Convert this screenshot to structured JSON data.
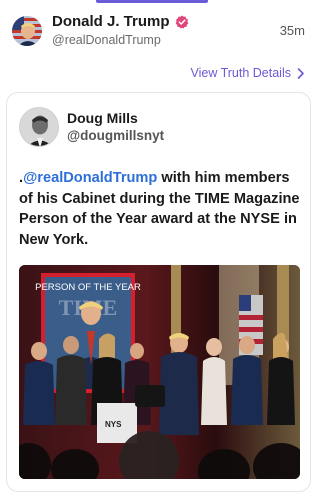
{
  "post": {
    "author": "Donald J. Trump",
    "handle": "@realDonaldTrump",
    "time": "35m",
    "view_details": "View Truth Details"
  },
  "quote": {
    "author": "Doug Mills",
    "handle": "@dougmillsnyt",
    "text_prefix": ".",
    "mention": "@realDonaldTrump",
    "text_rest": " with him members of his Cabinet  during the TIME Magazine Person of the Year award at the NYSE in New York.",
    "photo": {
      "cover_title": "PERSON OF THE YEAR",
      "cover_masthead": "TIME",
      "podium_label": "NYS"
    }
  },
  "colors": {
    "accent": "#6b5bd6",
    "mention": "#2d6fd8",
    "verified": "#e0457b"
  },
  "icons": [
    "verified-badge-icon",
    "chevron-right-icon"
  ]
}
